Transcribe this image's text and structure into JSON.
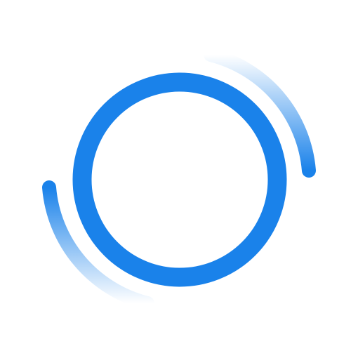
{
  "icon": {
    "name": "refresh-loader-icon",
    "colors": {
      "primary": "#1a82ea",
      "background": "#ffffff"
    }
  }
}
